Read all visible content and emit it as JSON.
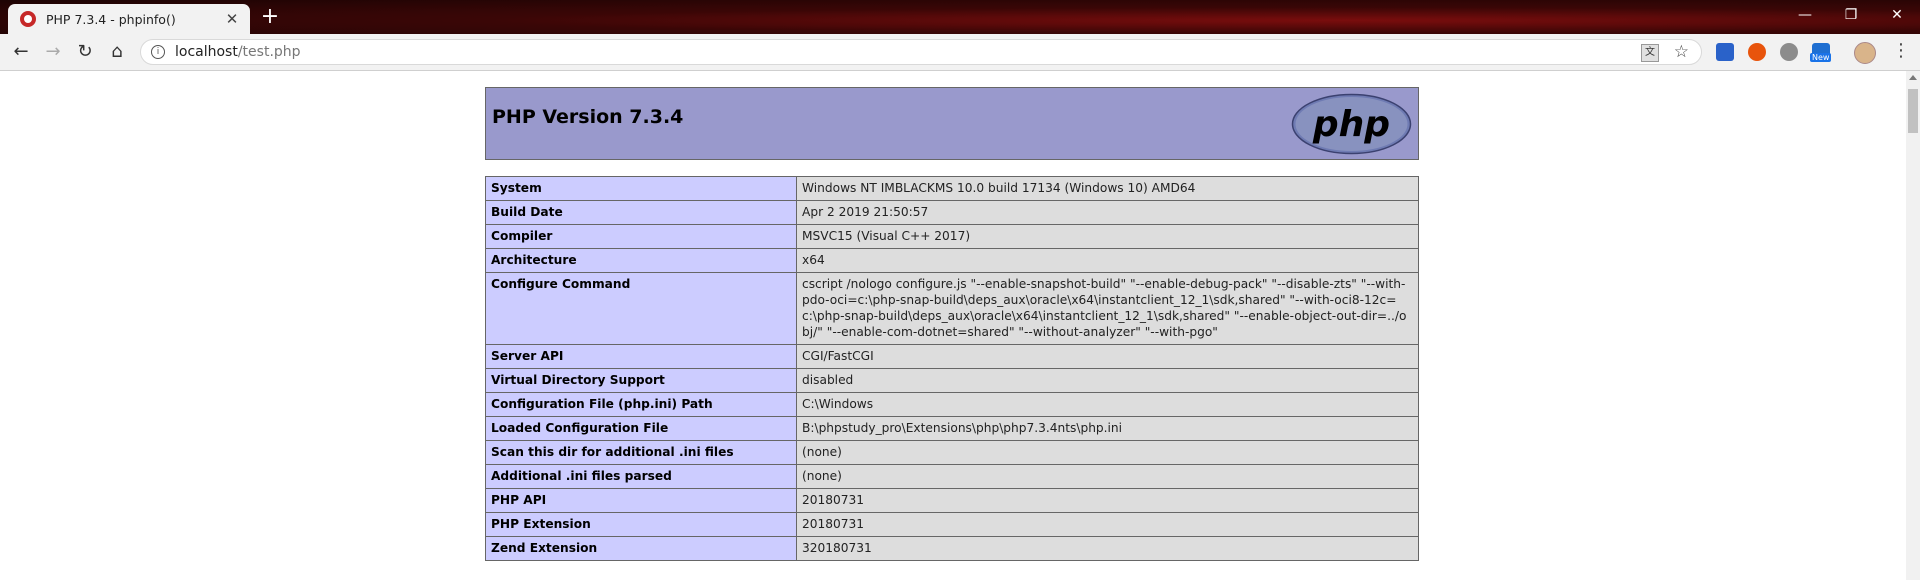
{
  "browser": {
    "tab_title": "PHP 7.3.4 - phpinfo()",
    "tab_close": "✕",
    "new_tab": "+",
    "url_host": "localhost",
    "url_path": "/test.php",
    "icons": [
      "back-icon",
      "forward-icon",
      "reload-icon",
      "home-icon",
      "info-icon",
      "translate-icon",
      "star-icon",
      "menu-icon"
    ]
  },
  "page": {
    "title": "PHP Version 7.3.4",
    "logo_text": "php",
    "rows": [
      {
        "key": "System",
        "value": "Windows NT IMBLACKMS 10.0 build 17134 (Windows 10) AMD64"
      },
      {
        "key": "Build Date",
        "value": "Apr 2 2019 21:50:57"
      },
      {
        "key": "Compiler",
        "value": "MSVC15 (Visual C++ 2017)"
      },
      {
        "key": "Architecture",
        "value": "x64"
      },
      {
        "key": "Configure Command",
        "value": "cscript /nologo configure.js \"--enable-snapshot-build\" \"--enable-debug-pack\" \"--disable-zts\" \"--with-pdo-oci=c:\\php-snap-build\\deps_aux\\oracle\\x64\\instantclient_12_1\\sdk,shared\" \"--with-oci8-12c=c:\\php-snap-build\\deps_aux\\oracle\\x64\\instantclient_12_1\\sdk,shared\" \"--enable-object-out-dir=../obj/\" \"--enable-com-dotnet=shared\" \"--without-analyzer\" \"--with-pgo\""
      },
      {
        "key": "Server API",
        "value": "CGI/FastCGI"
      },
      {
        "key": "Virtual Directory Support",
        "value": "disabled"
      },
      {
        "key": "Configuration File (php.ini) Path",
        "value": "C:\\Windows"
      },
      {
        "key": "Loaded Configuration File",
        "value": "B:\\phpstudy_pro\\Extensions\\php\\php7.3.4nts\\php.ini"
      },
      {
        "key": "Scan this dir for additional .ini files",
        "value": "(none)"
      },
      {
        "key": "Additional .ini files parsed",
        "value": "(none)"
      },
      {
        "key": "PHP API",
        "value": "20180731"
      },
      {
        "key": "PHP Extension",
        "value": "20180731"
      },
      {
        "key": "Zend Extension",
        "value": "320180731"
      }
    ]
  }
}
